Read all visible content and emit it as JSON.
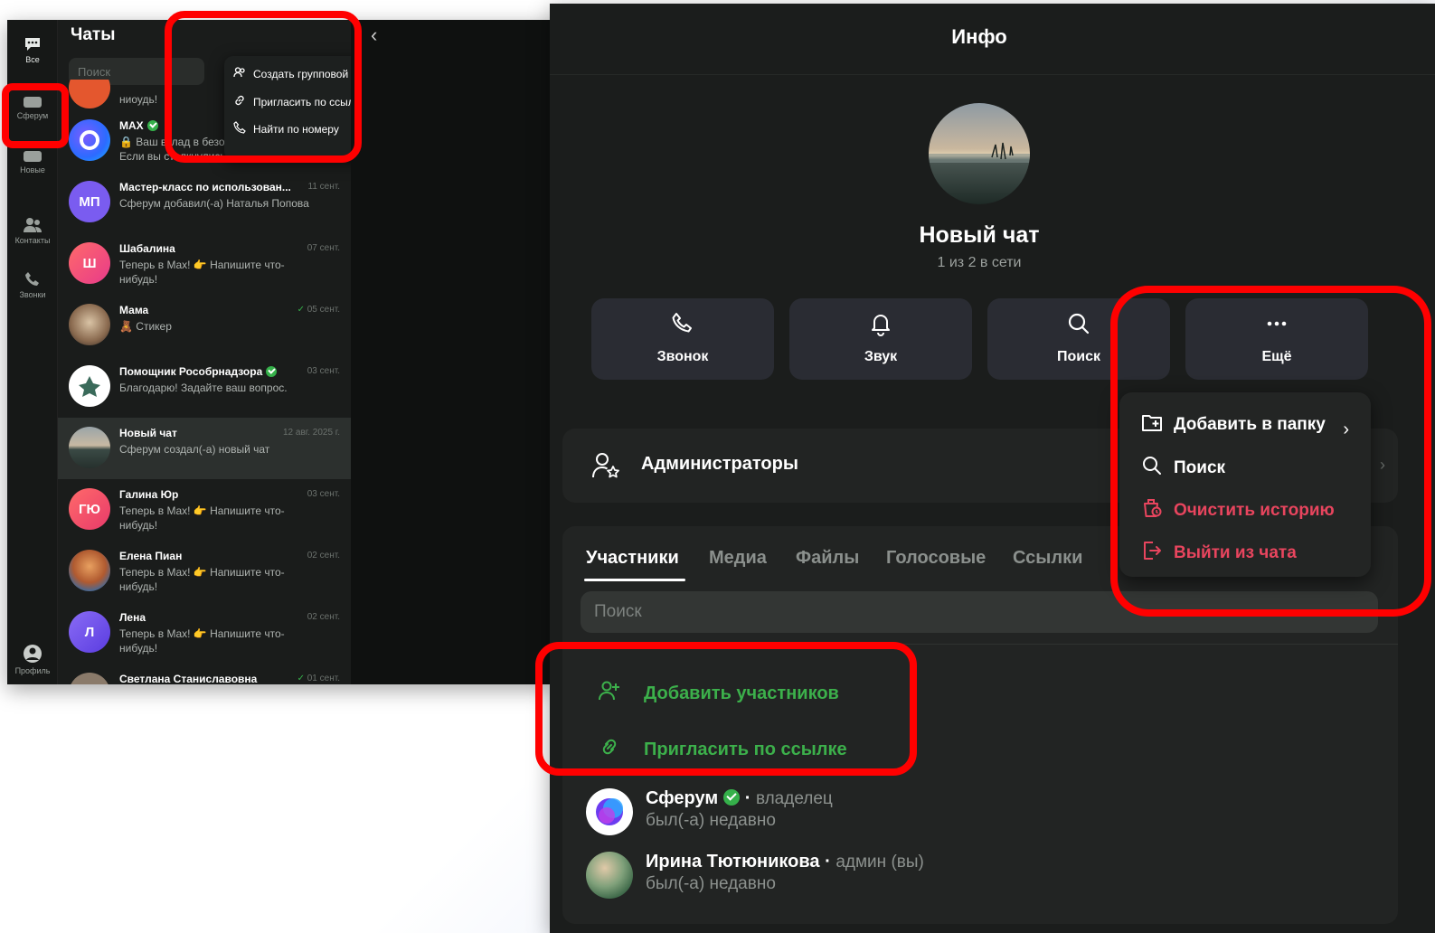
{
  "left": {
    "title": "Чаты",
    "search_placeholder": "Поиск",
    "rail": [
      {
        "label": "Все",
        "icon": "chat-bubble-icon"
      },
      {
        "label": "Сферум",
        "icon": "folder-icon"
      },
      {
        "label": "Новые",
        "icon": "folder-icon"
      },
      {
        "label": "Контакты",
        "icon": "contacts-icon"
      },
      {
        "label": "Звонки",
        "icon": "phone-icon"
      },
      {
        "label": "Профиль",
        "icon": "profile-icon"
      }
    ],
    "dropdown": [
      {
        "label": "Создать групповой чат",
        "icon": "group-icon"
      },
      {
        "label": "Пригласить по ссылке",
        "icon": "link-icon"
      },
      {
        "label": "Найти по номеру",
        "icon": "phone-icon"
      }
    ],
    "chats": [
      {
        "name": "",
        "date": "",
        "msg": "ниоудь!",
        "avatar_text": "",
        "avatar_color": "#e4572e"
      },
      {
        "name": "MAX",
        "date": "",
        "msg": "🔒 Ваш вклад в безопасность MAX Если вы столкнулись...",
        "avatar_text": "",
        "avatar_color": "#3b5bff",
        "verified": true
      },
      {
        "name": "Мастер-класс по использован...",
        "date": "11 сент.",
        "msg": "Сферум добавил(-а) Наталья Попова",
        "avatar_text": "МП",
        "avatar_color": "#7a5cf0"
      },
      {
        "name": "Шабалина",
        "date": "07 сент.",
        "msg": "Теперь в Max! 👉 Напишите что-нибудь!",
        "avatar_text": "Ш",
        "avatar_color": "#ee4a7a"
      },
      {
        "name": "Мама",
        "date": "05 сент.",
        "msg": "🧸 Стикер",
        "avatar_text": "",
        "avatar_color": "#6b4a3a"
      },
      {
        "name": "Помощник Рособрнадзора",
        "date": "03 сент.",
        "msg": "Благодарю! Задайте ваш вопрос.",
        "avatar_text": "",
        "avatar_color": "#ffffff",
        "verified": true
      },
      {
        "name": "Новый чат",
        "date": "12 авг. 2025 г.",
        "msg": "Сферум создал(-а) новый чат",
        "avatar_text": "",
        "avatar_color": "#5a6a6a",
        "active": true
      },
      {
        "name": "Галина Юр",
        "date": "03 сент.",
        "msg": "Теперь в Max! 👉 Напишите что-нибудь!",
        "avatar_text": "ГЮ",
        "avatar_color": "#f0505a"
      },
      {
        "name": "Елена Пиан",
        "date": "02 сент.",
        "msg": "Теперь в Max! 👉 Напишите что-нибудь!",
        "avatar_text": "",
        "avatar_color": "#4a78b0"
      },
      {
        "name": "Лена",
        "date": "02 сент.",
        "msg": "Теперь в Max! 👉 Напишите что-нибудь!",
        "avatar_text": "Л",
        "avatar_color": "#7a5cf0"
      },
      {
        "name": "Светлана Станиславовна",
        "date": "01 сент.",
        "msg": "",
        "avatar_text": "",
        "avatar_color": "#8a7a6a"
      }
    ]
  },
  "right": {
    "header_title": "Инфо",
    "chat_title": "Новый чат",
    "chat_sub": "1 из 2 в сети",
    "actions": [
      {
        "label": "Звонок",
        "icon": "phone-icon"
      },
      {
        "label": "Звук",
        "icon": "bell-icon"
      },
      {
        "label": "Поиск",
        "icon": "search-icon"
      },
      {
        "label": "Ещё",
        "icon": "more-icon"
      }
    ],
    "admins_label": "Администраторы",
    "tabs": [
      "Участники",
      "Медиа",
      "Файлы",
      "Голосовые",
      "Ссылки"
    ],
    "members_search_placeholder": "Поиск",
    "add_members": "Добавить участников",
    "invite_link": "Пригласить по ссылке",
    "members": [
      {
        "name": "Сферум",
        "role": "владелец",
        "status": "был(-а) недавно",
        "verified": true
      },
      {
        "name": "Ирина Тютюникова",
        "role": "админ (вы)",
        "status": "был(-а) недавно"
      }
    ],
    "more_menu": [
      {
        "label": "Добавить в папку",
        "icon": "folder-add-icon",
        "color": "white"
      },
      {
        "label": "Поиск",
        "icon": "search-icon",
        "color": "white"
      },
      {
        "label": "Очистить историю",
        "icon": "clear-history-icon",
        "color": "red"
      },
      {
        "label": "Выйти из чата",
        "icon": "exit-icon",
        "color": "red"
      }
    ]
  },
  "colors": {
    "accent_green": "#3cb04b",
    "danger_red": "#e8455e",
    "highlight_red": "#ff0000"
  }
}
